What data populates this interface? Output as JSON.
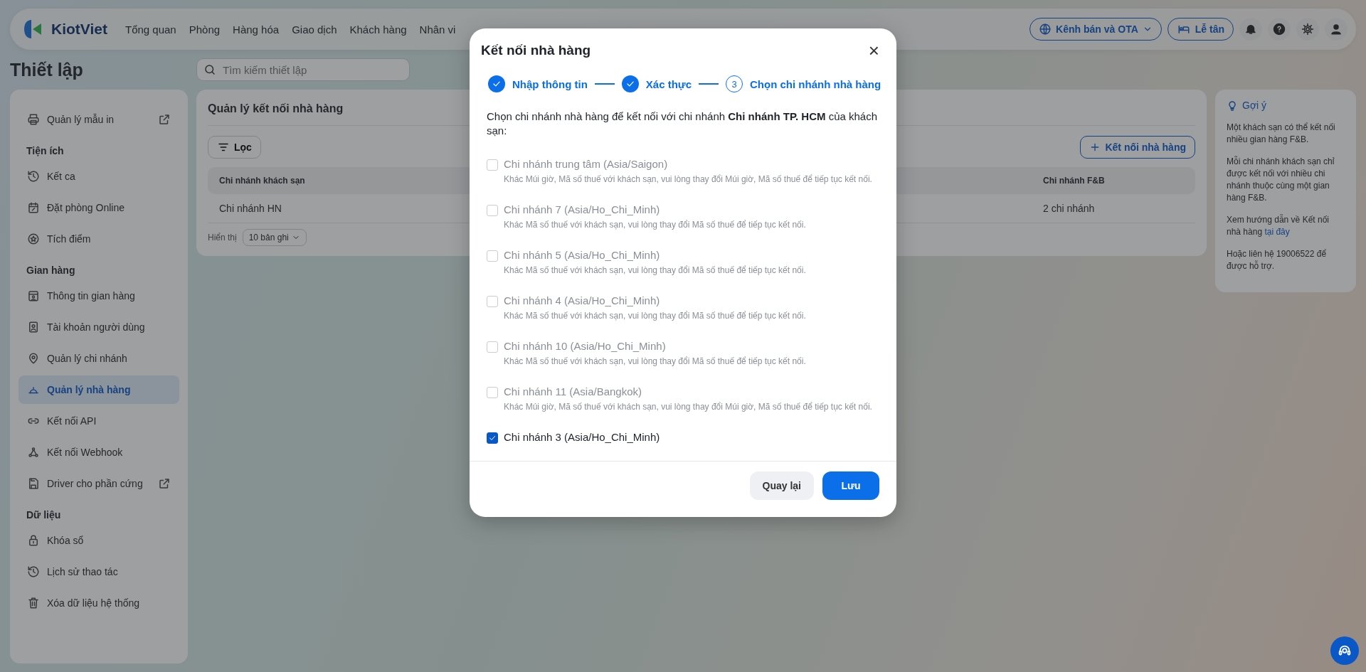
{
  "top_nav": {
    "logo": "KiotViet",
    "items": [
      "Tổng quan",
      "Phòng",
      "Hàng hóa",
      "Giao dịch",
      "Khách hàng",
      "Nhân vi"
    ],
    "channel_button": "Kênh bán và OTA",
    "reception_button": "Lễ tân"
  },
  "page_title": "Thiết lập",
  "search": {
    "placeholder": "Tìm kiếm thiết lập"
  },
  "sidebar": {
    "sections": [
      {
        "items": [
          {
            "label": "Quản lý mẫu in",
            "selected": false,
            "external": true
          }
        ]
      },
      {
        "title": "Tiện ích",
        "items": [
          {
            "label": "Kết ca",
            "selected": false,
            "external": false
          },
          {
            "label": "Đặt phòng Online",
            "selected": false,
            "external": false
          },
          {
            "label": "Tích điểm",
            "selected": false,
            "external": false
          }
        ]
      },
      {
        "title": "Gian hàng",
        "items": [
          {
            "label": "Thông tin gian hàng",
            "selected": false,
            "external": false
          },
          {
            "label": "Tài khoản người dùng",
            "selected": false,
            "external": false
          },
          {
            "label": "Quản lý chi nhánh",
            "selected": false,
            "external": false
          },
          {
            "label": "Quản lý nhà hàng",
            "selected": true,
            "external": false
          },
          {
            "label": "Kết nối API",
            "selected": false,
            "external": false
          },
          {
            "label": "Kết nối Webhook",
            "selected": false,
            "external": false
          },
          {
            "label": "Driver cho phần cứng",
            "selected": false,
            "external": true
          }
        ]
      },
      {
        "title": "Dữ liệu",
        "items": [
          {
            "label": "Khóa sổ",
            "selected": false,
            "external": false
          },
          {
            "label": "Lịch sử thao tác",
            "selected": false,
            "external": false
          },
          {
            "label": "Xóa dữ liệu hệ thống",
            "selected": false,
            "external": false
          }
        ]
      }
    ]
  },
  "main": {
    "title": "Quản lý kết nối nhà hàng",
    "filter_button": "Lọc",
    "add_button": "Kết nối nhà hàng",
    "table": {
      "columns": [
        "Chi nhánh khách sạn",
        "Chi nhánh F&B"
      ],
      "rows": [
        [
          "Chi nhánh HN",
          "2 chi nhánh"
        ]
      ]
    },
    "page_size_label": "Hiển thị",
    "page_size": "10 bản ghi"
  },
  "hint": {
    "title": "Gợi ý",
    "paragraphs": [
      "Một khách sạn có thể kết nối nhiều gian hàng F&B.",
      "Mỗi chi nhánh khách sạn chỉ được kết nối với nhiều chi nhánh thuộc cùng một gian hàng F&B."
    ],
    "guide_text": "Xem hướng dẫn về Kết nối nhà hàng",
    "guide_link": "tại đây",
    "contact": "Hoặc liên hệ 19006522 để được hỗ trợ."
  },
  "modal": {
    "title": "Kết nối nhà hàng",
    "close": "×",
    "steps": [
      {
        "label": "Nhập thông tin",
        "done": true
      },
      {
        "label": "Xác thực",
        "done": true
      },
      {
        "label": "Chọn chi nhánh nhà hàng",
        "done": false,
        "number": "3"
      }
    ],
    "intro": "Chọn chi nhánh nhà hàng để kết nối với chi nhánh **Chi nhánh TP. HCM** của khách sạn:",
    "options": [
      {
        "label": "Chi nhánh trung tâm (Asia/Saigon)",
        "note": "Khác Múi giờ, Mã số thuế với khách sạn, vui lòng thay đổi Múi giờ, Mã số thuế để tiếp tục kết nối.",
        "checked": false,
        "disabled": true
      },
      {
        "label": "Chi nhánh 7 (Asia/Ho_Chi_Minh)",
        "note": "Khác Mã số thuế với khách sạn, vui lòng thay đổi Mã số thuế để tiếp tục kết nối.",
        "checked": false,
        "disabled": true
      },
      {
        "label": "Chi nhánh 5 (Asia/Ho_Chi_Minh)",
        "note": "Khác Mã số thuế với khách sạn, vui lòng thay đổi Mã số thuế để tiếp tục kết nối.",
        "checked": false,
        "disabled": true
      },
      {
        "label": "Chi nhánh 4 (Asia/Ho_Chi_Minh)",
        "note": "Khác Mã số thuế với khách sạn, vui lòng thay đổi Mã số thuế để tiếp tục kết nối.",
        "checked": false,
        "disabled": true
      },
      {
        "label": "Chi nhánh 10 (Asia/Ho_Chi_Minh)",
        "note": "Khác Mã số thuế với khách sạn, vui lòng thay đổi Mã số thuế để tiếp tục kết nối.",
        "checked": false,
        "disabled": true
      },
      {
        "label": "Chi nhánh 11 (Asia/Bangkok)",
        "note": "Khác Múi giờ, Mã số thuế với khách sạn, vui lòng thay đổi Múi giờ, Mã số thuế để tiếp tục kết nối.",
        "checked": false,
        "disabled": true
      },
      {
        "label": "Chi nhánh 3 (Asia/Ho_Chi_Minh)",
        "checked": true,
        "disabled": false
      }
    ],
    "back_button": "Quay lại",
    "save_button": "Lưu"
  }
}
